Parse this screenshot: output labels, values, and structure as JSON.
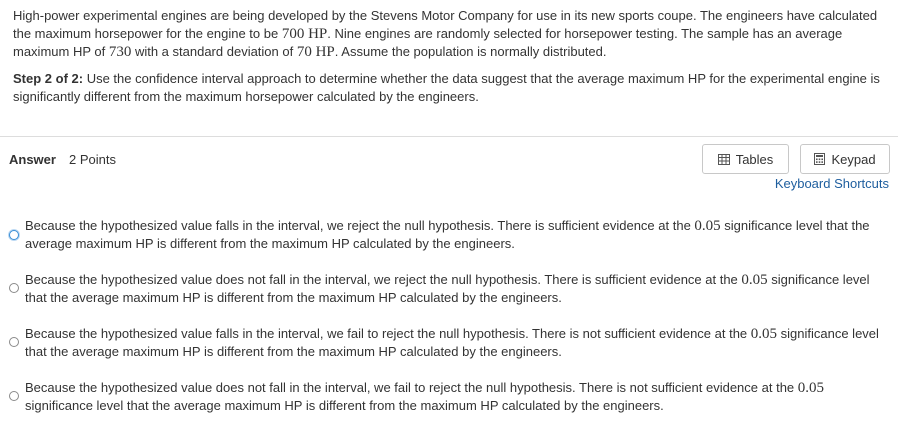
{
  "question": {
    "intro_part1": "High-power experimental engines are being developed by the Stevens Motor Company for use in its new sports coupe. The engineers have calculated the maximum horsepower for the engine to be ",
    "intro_math1": "700 HP",
    "intro_part2": ". Nine engines are randomly selected for horsepower testing. The sample has an average maximum HP of ",
    "intro_math2": "730",
    "intro_part3": " with a standard deviation of ",
    "intro_math3": "70 HP",
    "intro_part4": ". Assume the population is normally distributed.",
    "step_label": "Step 2 of 2:",
    "step_text": " Use the confidence interval approach to determine whether the data suggest that the average maximum HP for the experimental engine is significantly different from the maximum horsepower calculated by the engineers."
  },
  "answer": {
    "label": "Answer",
    "points": "2 Points"
  },
  "toolbar": {
    "tables_label": "Tables",
    "keypad_label": "Keypad",
    "shortcuts_label": "Keyboard Shortcuts",
    "link_color": "#1e5e9e"
  },
  "options": [
    {
      "text_before": "Because the hypothesized value falls in the interval, we reject the null hypothesis. There is sufficient evidence at the ",
      "math": "0.05",
      "text_after": " significance level that the average maximum HP is different from the maximum HP calculated by the engineers.",
      "focused": true
    },
    {
      "text_before": "Because the hypothesized value does not fall in the interval, we reject the null hypothesis. There is sufficient evidence at the ",
      "math": "0.05",
      "text_after": " significance level that the average maximum HP is different from the maximum HP calculated by the engineers.",
      "focused": false
    },
    {
      "text_before": "Because the hypothesized value falls in the interval, we fail to reject the null hypothesis. There is not sufficient evidence at the ",
      "math": "0.05",
      "text_after": " significance level that the average maximum HP is different from the maximum HP calculated by the engineers.",
      "focused": false
    },
    {
      "text_before": "Because the hypothesized value does not fall in the interval, we fail to reject the null hypothesis. There is not sufficient evidence at the ",
      "math": "0.05",
      "text_after": " significance level that the average maximum HP is different from the maximum HP calculated by the engineers.",
      "focused": false
    }
  ]
}
